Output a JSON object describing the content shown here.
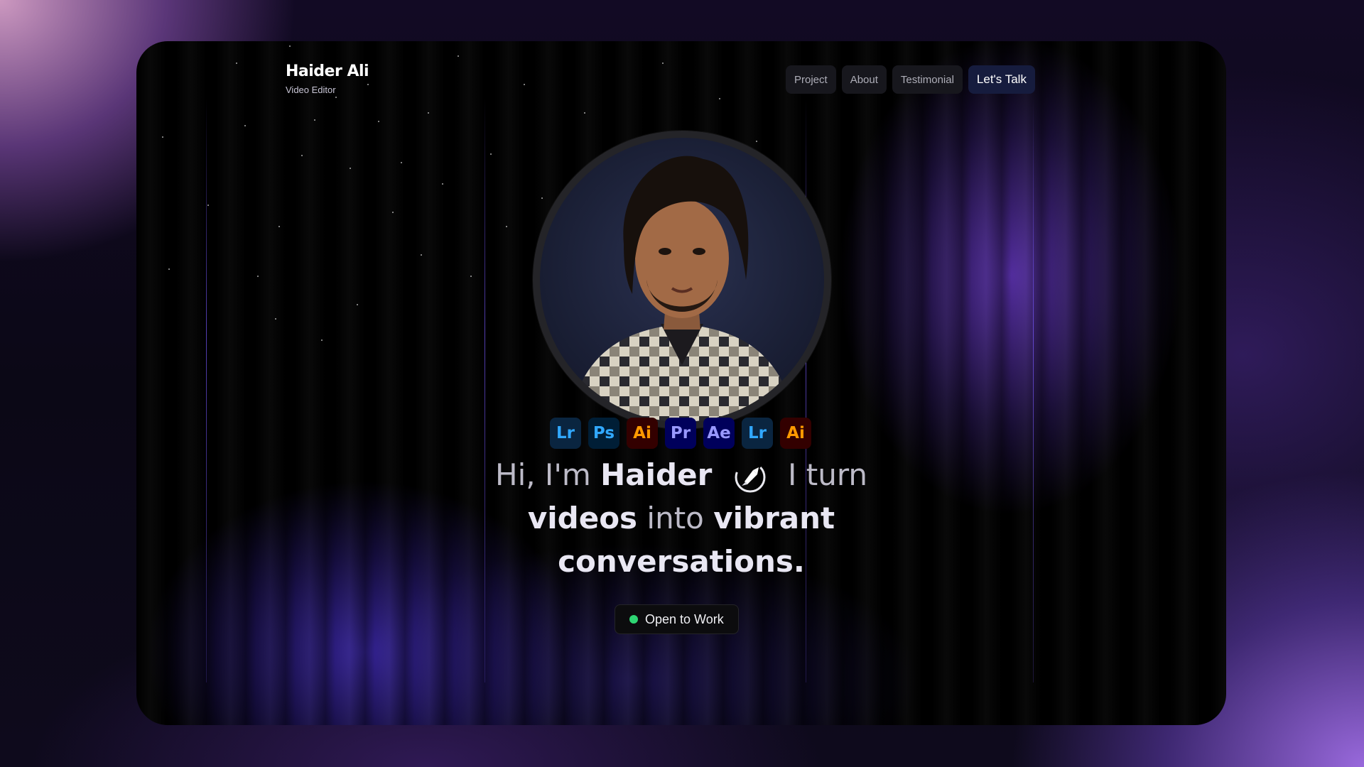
{
  "brand": {
    "name": "Haider Ali",
    "role": "Video Editor"
  },
  "nav": {
    "items": [
      {
        "label": "Project"
      },
      {
        "label": "About"
      },
      {
        "label": "Testimonial"
      }
    ],
    "cta_label": "Let's Talk"
  },
  "tools": [
    {
      "label": "Lr",
      "bg": "#0a2540",
      "fg": "#31a8ff"
    },
    {
      "label": "Ps",
      "bg": "#001e36",
      "fg": "#31a8ff"
    },
    {
      "label": "Ai",
      "bg": "#330000",
      "fg": "#ff9a00"
    },
    {
      "label": "Pr",
      "bg": "#00005b",
      "fg": "#9999ff"
    },
    {
      "label": "Ae",
      "bg": "#00005b",
      "fg": "#9999ff"
    },
    {
      "label": "Lr",
      "bg": "#0a2540",
      "fg": "#31a8ff"
    },
    {
      "label": "Ai",
      "bg": "#330000",
      "fg": "#ff9a00"
    }
  ],
  "headline": {
    "greeting": "Hi, I'm",
    "name": "Haider",
    "icon": "rocket-icon",
    "turn": "I turn",
    "word1": "videos",
    "connector": "into",
    "word2": "vibrant",
    "word3": "conversations."
  },
  "status": {
    "label": "Open to Work",
    "color": "#2ed573"
  },
  "colors": {
    "accent": "#161c3e",
    "card_bg": "#000000"
  }
}
